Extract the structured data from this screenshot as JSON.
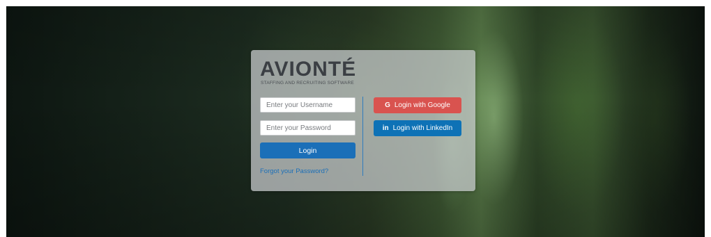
{
  "brand": {
    "name": "AVIONTÉ",
    "tagline": "STAFFING AND RECRUITING SOFTWARE"
  },
  "form": {
    "username_placeholder": "Enter your Username",
    "password_placeholder": "Enter your Password",
    "login_label": "Login",
    "forgot_label": "Forgot your Password?"
  },
  "social": {
    "google_label": "Login with Google",
    "google_icon": "G",
    "linkedin_label": "Login with LinkedIn",
    "linkedin_icon": "in"
  },
  "colors": {
    "primary_blue": "#1b6fb8",
    "google_red": "#d9534f",
    "linkedin_blue": "#0e72b6"
  }
}
